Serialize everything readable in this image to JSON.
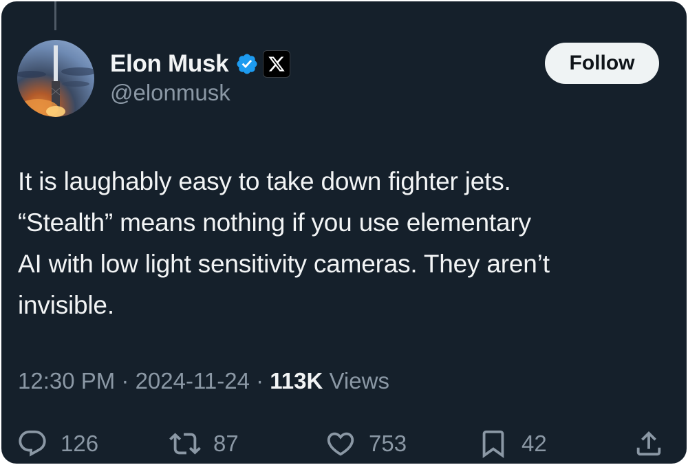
{
  "author": {
    "name": "Elon Musk",
    "handle": "@elonmusk",
    "verified_color": "#1d9bf0"
  },
  "follow_button": {
    "label": "Follow"
  },
  "tweet": {
    "lines": [
      "It is laughably easy to take down fighter jets.",
      "“Stealth” means nothing if you use elementary",
      "AI with low light sensitivity cameras. They aren’t",
      "invisible."
    ]
  },
  "meta": {
    "time": "12:30 PM",
    "separator": " · ",
    "date": "2024-11-24",
    "views_count": "113K",
    "views_label": " Views"
  },
  "actions": {
    "replies": {
      "icon": "reply-icon",
      "count": "126"
    },
    "reposts": {
      "icon": "repost-icon",
      "count": "87"
    },
    "likes": {
      "icon": "heart-icon",
      "count": "753"
    },
    "bookmarks": {
      "icon": "bookmark-icon",
      "count": "42"
    },
    "share": {
      "icon": "share-icon"
    }
  },
  "colors": {
    "background": "#15202b",
    "text": "#f2f4f5",
    "secondary_text": "#8b98a5",
    "follow_button_bg": "#eff3f4"
  }
}
